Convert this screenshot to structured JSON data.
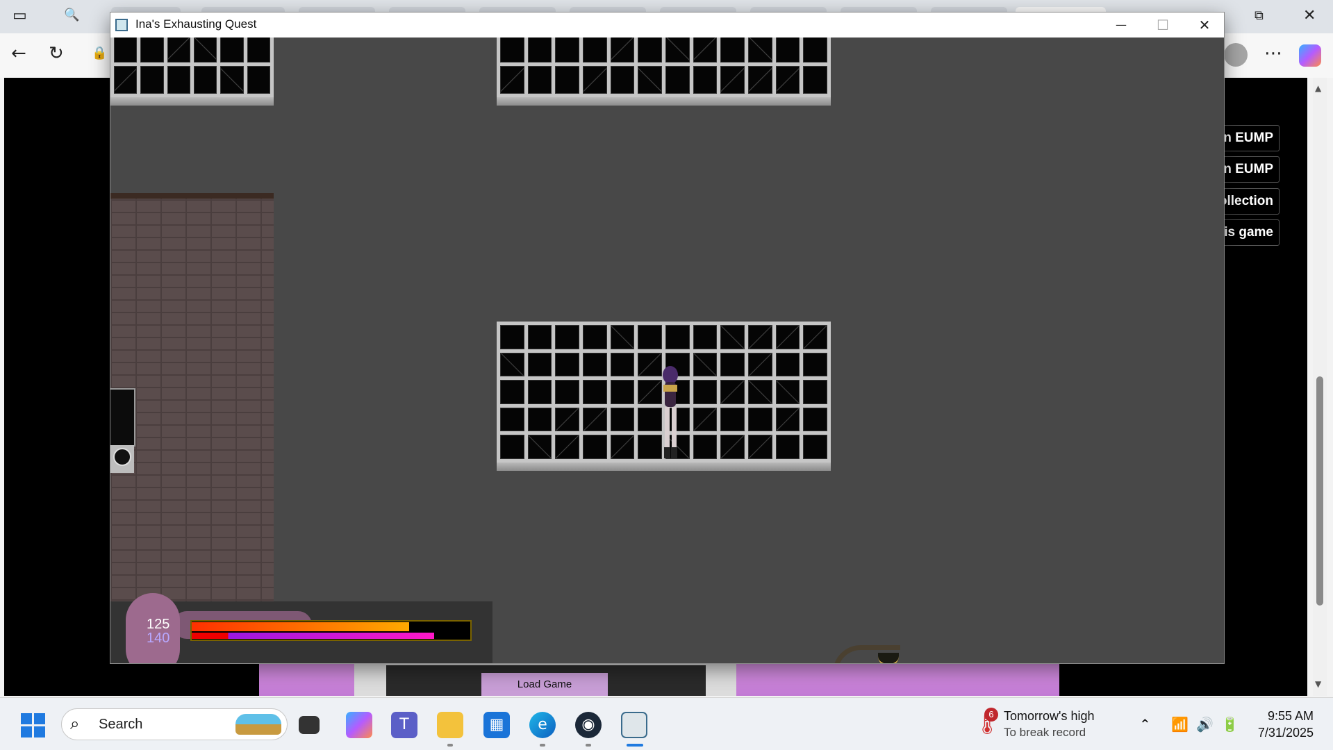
{
  "game_window": {
    "title": "Ina's Exhausting Quest",
    "minimize": "—",
    "maximize": "☐",
    "close": "✕"
  },
  "browser": {
    "side_buttons": [
      "y Colin EUMP",
      "y Colin EUMP",
      "To Collection",
      "ate this game"
    ],
    "back_icon": "←",
    "reload_icon": "↻",
    "menu_icon": "⋯"
  },
  "hud": {
    "hp_value": "125",
    "mp_value": "140",
    "hp_fraction": 0.78,
    "mp_fraction": 0.87
  },
  "overlay": {
    "load_game_label": "Load Game"
  },
  "taskbar": {
    "search_label": "Search",
    "weather_badge": "6",
    "weather_line1": "Tomorrow's high",
    "weather_line2": "To break record",
    "time": "9:55 AM",
    "date": "7/31/2025"
  },
  "colors": {
    "hp_start": "#ff3000",
    "hp_end": "#ffaa00",
    "mp_accent": "#9b18e0",
    "background": "#484848"
  }
}
